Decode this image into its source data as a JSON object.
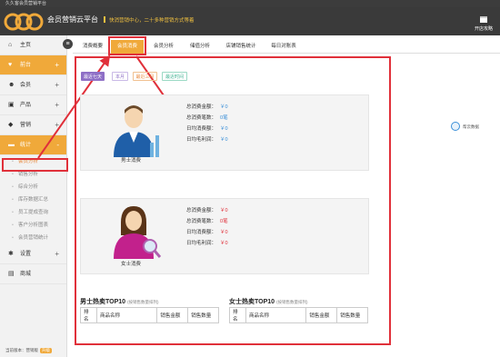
{
  "window": {
    "title": "久久客会员营销平台"
  },
  "header": {
    "brand": "会员营销云平台",
    "tagline": "快消营销中心，二十多种营销方式等着",
    "store_button": "开店攻略"
  },
  "sidebar": {
    "items": [
      {
        "label": "主页",
        "icon": "home-icon",
        "expandable": false
      },
      {
        "label": "前台",
        "icon": "heart-icon",
        "expandable": true
      },
      {
        "label": "会员",
        "icon": "users-icon",
        "expandable": true
      },
      {
        "label": "产品",
        "icon": "box-icon",
        "expandable": true
      },
      {
        "label": "营销",
        "icon": "tag-icon",
        "expandable": true
      },
      {
        "label": "统计",
        "icon": "folder-icon",
        "expandable": true,
        "expanded": true
      }
    ],
    "sub_items": [
      "会员分析",
      "销售分析",
      "综合分析",
      "库存数据汇总",
      "员工提成查询",
      "客户分析图表",
      "会员营销统计"
    ],
    "bottom_items": [
      {
        "label": "设置",
        "icon": "gear-icon",
        "expandable": true
      },
      {
        "label": "商城",
        "icon": "shop-icon",
        "expandable": false
      }
    ],
    "footer": {
      "label": "当前版本：营销版",
      "badge": "升级"
    }
  },
  "tabs": [
    "消费概要",
    "会员消费",
    "会员分析",
    "储值分析",
    "店铺销售统计",
    "每日对账表"
  ],
  "active_tab": 1,
  "filters": [
    "最近七天",
    "本月",
    "最近三月",
    "最近时间"
  ],
  "male_card": {
    "label": "男士消费",
    "stats": [
      {
        "label": "总消费金额：",
        "value": "￥0"
      },
      {
        "label": "总消费笔数：",
        "value": "0笔"
      },
      {
        "label": "日均消费额：",
        "value": "￥0"
      },
      {
        "label": "日均毛利润：",
        "value": "￥0"
      }
    ]
  },
  "female_card": {
    "label": "女士消费",
    "stats": [
      {
        "label": "总消费金额：",
        "value": "￥0"
      },
      {
        "label": "总消费笔数：",
        "value": "0笔"
      },
      {
        "label": "日均消费额：",
        "value": "￥0"
      },
      {
        "label": "日均毛利润：",
        "value": "￥0"
      }
    ]
  },
  "top10_male": {
    "title": "男士热卖TOP10",
    "hint": "(按销售数量排列)",
    "columns": [
      "排名",
      "商品名称",
      "销售金额",
      "销售数量"
    ]
  },
  "top10_female": {
    "title": "女士热卖TOP10",
    "hint": "(按销售数量排列)",
    "columns": [
      "排名",
      "商品名称",
      "销售金额",
      "销售数量"
    ]
  },
  "float_label": "帮云数据",
  "colors": {
    "accent": "#f0a93a",
    "highlight": "#e0303a",
    "value_blue": "#3a8fd8",
    "filter_purple": "#8e6fc6",
    "filter_orange": "#e8873a",
    "filter_green": "#3ab08e"
  }
}
